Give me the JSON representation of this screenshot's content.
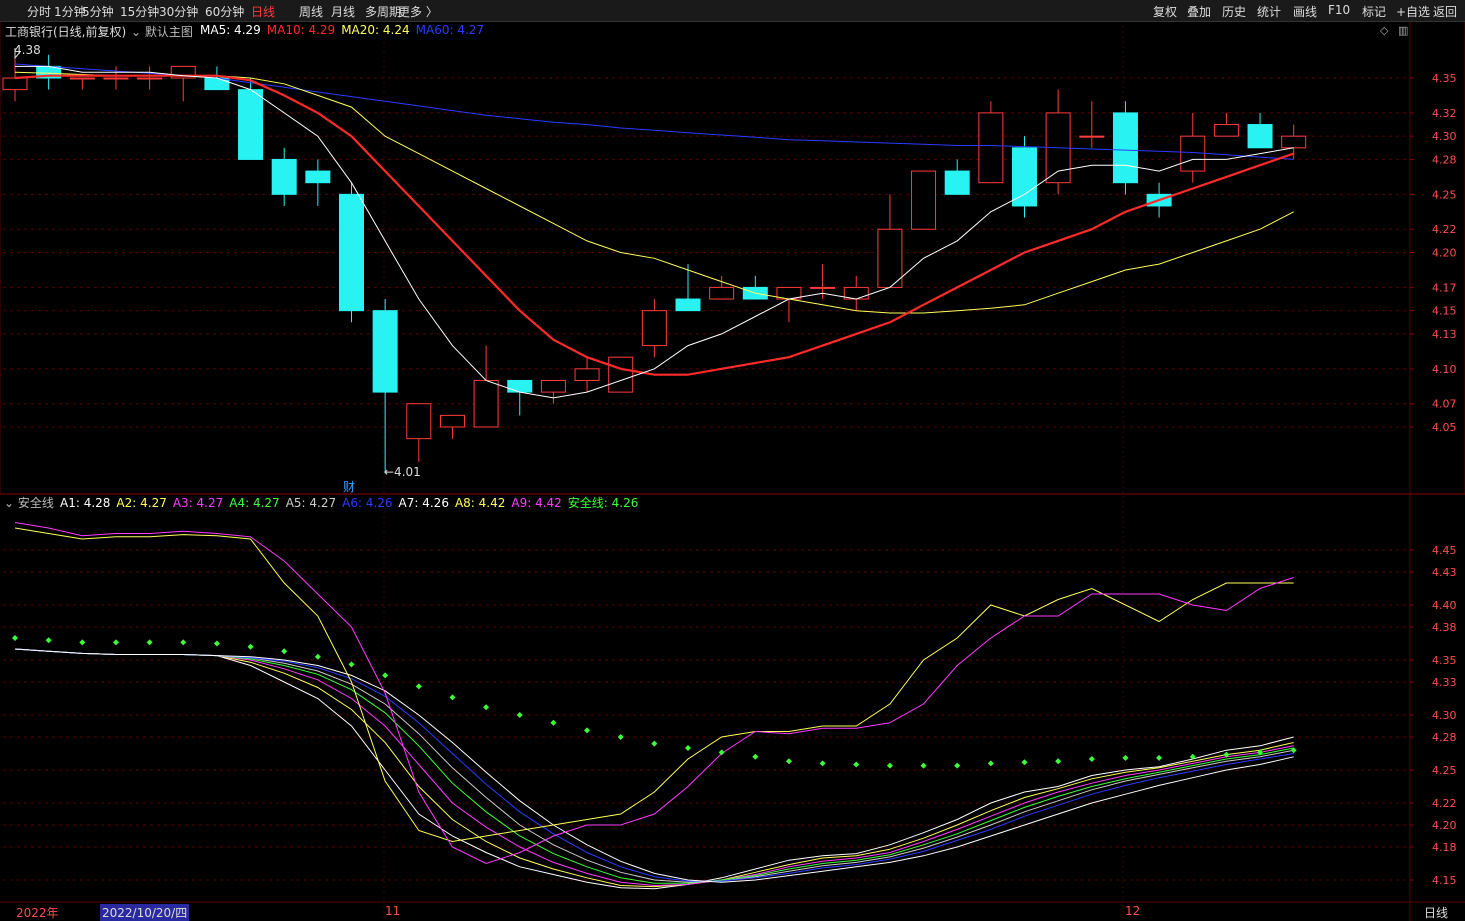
{
  "toolbar": {
    "periods": [
      "分时",
      "1分钟",
      "5分钟",
      "15分钟",
      "30分钟",
      "60分钟",
      "日线",
      "周线",
      "月线",
      "多周期",
      "更多 〉"
    ],
    "active_period": "日线",
    "right_buttons": [
      "复权",
      "叠加",
      "历史",
      "统计",
      "画线",
      "F10",
      "标记",
      "+自选",
      "返回"
    ]
  },
  "main_panel": {
    "stock_name": "工商银行(日线,前复权)",
    "template": "默认主图",
    "ma_legend": [
      {
        "label": "MA5: 4.29",
        "color": "#ffffff"
      },
      {
        "label": "MA10: 4.29",
        "color": "#ff2a2a"
      },
      {
        "label": "MA20: 4.24",
        "color": "#ffff5a"
      },
      {
        "label": "MA60: 4.27",
        "color": "#2a3cff"
      }
    ],
    "high_marker": "4.38",
    "low_marker": "←4.01",
    "event_marker": "财"
  },
  "sub_panel": {
    "indicator": "安全线",
    "legend": [
      {
        "label": "A1: 4.28",
        "color": "#ffffff"
      },
      {
        "label": "A2: 4.27",
        "color": "#ffff5a"
      },
      {
        "label": "A3: 4.27",
        "color": "#ff3cff"
      },
      {
        "label": "A4: 4.27",
        "color": "#3cff3c"
      },
      {
        "label": "A5: 4.27",
        "color": "#cccccc"
      },
      {
        "label": "A6: 4.26",
        "color": "#2a3cff"
      },
      {
        "label": "A7: 4.26",
        "color": "#ffffff"
      },
      {
        "label": "A8: 4.42",
        "color": "#ffff5a"
      },
      {
        "label": "A9: 4.42",
        "color": "#ff3cff"
      },
      {
        "label": "安全线: 4.26",
        "color": "#3cff3c"
      }
    ]
  },
  "bottom_axis": {
    "labels": [
      "2022年",
      "2022/10/20/四",
      "11",
      "12"
    ],
    "period_label": "日线"
  },
  "colors": {
    "up": "#ff3b3b",
    "down": "#29f2f2",
    "ma5": "#ffffff",
    "ma10": "#ff2a2a",
    "ma20": "#ffff5a",
    "ma60": "#2a3cff",
    "safety": "#3cff3c",
    "grid": "#5a0000"
  },
  "chart_data": [
    {
      "type": "candlestick",
      "title": "工商银行(日线,前复权)",
      "y_ticks": [
        4.35,
        4.32,
        4.3,
        4.28,
        4.25,
        4.22,
        4.2,
        4.17,
        4.15,
        4.13,
        4.1,
        4.07,
        4.05
      ],
      "ylim": [
        4.01,
        4.38
      ],
      "candles": [
        {
          "o": 4.34,
          "h": 4.37,
          "l": 4.33,
          "c": 4.35
        },
        {
          "o": 4.36,
          "h": 4.37,
          "l": 4.34,
          "c": 4.35
        },
        {
          "o": 4.35,
          "h": 4.35,
          "l": 4.34,
          "c": 4.35
        },
        {
          "o": 4.35,
          "h": 4.36,
          "l": 4.34,
          "c": 4.35
        },
        {
          "o": 4.35,
          "h": 4.36,
          "l": 4.34,
          "c": 4.35
        },
        {
          "o": 4.35,
          "h": 4.36,
          "l": 4.33,
          "c": 4.36
        },
        {
          "o": 4.35,
          "h": 4.36,
          "l": 4.34,
          "c": 4.34
        },
        {
          "o": 4.34,
          "h": 4.35,
          "l": 4.28,
          "c": 4.28
        },
        {
          "o": 4.28,
          "h": 4.29,
          "l": 4.24,
          "c": 4.25
        },
        {
          "o": 4.27,
          "h": 4.28,
          "l": 4.24,
          "c": 4.26
        },
        {
          "o": 4.25,
          "h": 4.26,
          "l": 4.14,
          "c": 4.15
        },
        {
          "o": 4.15,
          "h": 4.16,
          "l": 4.01,
          "c": 4.08
        },
        {
          "o": 4.04,
          "h": 4.07,
          "l": 4.02,
          "c": 4.07
        },
        {
          "o": 4.05,
          "h": 4.06,
          "l": 4.04,
          "c": 4.06
        },
        {
          "o": 4.05,
          "h": 4.12,
          "l": 4.05,
          "c": 4.09
        },
        {
          "o": 4.09,
          "h": 4.09,
          "l": 4.06,
          "c": 4.08
        },
        {
          "o": 4.08,
          "h": 4.09,
          "l": 4.07,
          "c": 4.09
        },
        {
          "o": 4.09,
          "h": 4.11,
          "l": 4.08,
          "c": 4.1
        },
        {
          "o": 4.08,
          "h": 4.11,
          "l": 4.08,
          "c": 4.11
        },
        {
          "o": 4.12,
          "h": 4.16,
          "l": 4.11,
          "c": 4.15
        },
        {
          "o": 4.16,
          "h": 4.19,
          "l": 4.15,
          "c": 4.15
        },
        {
          "o": 4.16,
          "h": 4.18,
          "l": 4.16,
          "c": 4.17
        },
        {
          "o": 4.17,
          "h": 4.18,
          "l": 4.16,
          "c": 4.16
        },
        {
          "o": 4.16,
          "h": 4.17,
          "l": 4.14,
          "c": 4.17
        },
        {
          "o": 4.17,
          "h": 4.19,
          "l": 4.16,
          "c": 4.17
        },
        {
          "o": 4.16,
          "h": 4.18,
          "l": 4.15,
          "c": 4.17
        },
        {
          "o": 4.17,
          "h": 4.25,
          "l": 4.17,
          "c": 4.22
        },
        {
          "o": 4.22,
          "h": 4.27,
          "l": 4.22,
          "c": 4.27
        },
        {
          "o": 4.27,
          "h": 4.28,
          "l": 4.25,
          "c": 4.25
        },
        {
          "o": 4.26,
          "h": 4.33,
          "l": 4.26,
          "c": 4.32
        },
        {
          "o": 4.29,
          "h": 4.3,
          "l": 4.23,
          "c": 4.24
        },
        {
          "o": 4.26,
          "h": 4.34,
          "l": 4.25,
          "c": 4.32
        },
        {
          "o": 4.3,
          "h": 4.33,
          "l": 4.29,
          "c": 4.3
        },
        {
          "o": 4.32,
          "h": 4.33,
          "l": 4.25,
          "c": 4.26
        },
        {
          "o": 4.25,
          "h": 4.26,
          "l": 4.23,
          "c": 4.24
        },
        {
          "o": 4.27,
          "h": 4.32,
          "l": 4.26,
          "c": 4.3
        },
        {
          "o": 4.3,
          "h": 4.32,
          "l": 4.3,
          "c": 4.31
        },
        {
          "o": 4.31,
          "h": 4.32,
          "l": 4.29,
          "c": 4.29
        },
        {
          "o": 4.29,
          "h": 4.31,
          "l": 4.28,
          "c": 4.3
        }
      ],
      "ma": {
        "MA5": [
          4.36,
          4.36,
          4.355,
          4.355,
          4.355,
          4.352,
          4.35,
          4.34,
          4.32,
          4.3,
          4.26,
          4.21,
          4.16,
          4.12,
          4.09,
          4.08,
          4.075,
          4.08,
          4.09,
          4.1,
          4.12,
          4.13,
          4.145,
          4.16,
          4.165,
          4.16,
          4.17,
          4.195,
          4.21,
          4.235,
          4.25,
          4.27,
          4.275,
          4.275,
          4.27,
          4.28,
          4.28,
          4.285,
          4.29
        ],
        "MA10": [
          4.35,
          4.352,
          4.352,
          4.352,
          4.352,
          4.352,
          4.352,
          4.348,
          4.335,
          4.32,
          4.3,
          4.27,
          4.24,
          4.21,
          4.18,
          4.15,
          4.125,
          4.11,
          4.1,
          4.095,
          4.095,
          4.1,
          4.105,
          4.11,
          4.12,
          4.13,
          4.14,
          4.155,
          4.17,
          4.185,
          4.2,
          4.21,
          4.22,
          4.235,
          4.245,
          4.255,
          4.265,
          4.275,
          4.285
        ],
        "MA20": [
          4.355,
          4.354,
          4.353,
          4.352,
          4.352,
          4.352,
          4.352,
          4.35,
          4.345,
          4.335,
          4.325,
          4.3,
          4.285,
          4.27,
          4.255,
          4.24,
          4.225,
          4.21,
          4.2,
          4.195,
          4.185,
          4.175,
          4.165,
          4.16,
          4.155,
          4.15,
          4.148,
          4.148,
          4.15,
          4.152,
          4.155,
          4.165,
          4.175,
          4.185,
          4.19,
          4.2,
          4.21,
          4.22,
          4.235
        ],
        "MA60": [
          4.362,
          4.36,
          4.358,
          4.356,
          4.354,
          4.352,
          4.35,
          4.346,
          4.342,
          4.338,
          4.334,
          4.33,
          4.326,
          4.322,
          4.318,
          4.315,
          4.312,
          4.31,
          4.307,
          4.305,
          4.303,
          4.301,
          4.299,
          4.297,
          4.296,
          4.295,
          4.294,
          4.293,
          4.292,
          4.292,
          4.291,
          4.29,
          4.289,
          4.288,
          4.287,
          4.286,
          4.284,
          4.282,
          4.28
        ]
      }
    },
    {
      "type": "line",
      "title": "安全线",
      "y_ticks": [
        4.45,
        4.43,
        4.4,
        4.38,
        4.35,
        4.33,
        4.3,
        4.28,
        4.25,
        4.22,
        4.2,
        4.18,
        4.15
      ],
      "ylim": [
        4.13,
        4.48
      ],
      "series": [
        {
          "name": "A1",
          "color": "#ffffff",
          "values": [
            4.36,
            4.358,
            4.356,
            4.355,
            4.355,
            4.355,
            4.354,
            4.345,
            4.33,
            4.315,
            4.29,
            4.25,
            4.21,
            4.19,
            4.175,
            4.162,
            4.155,
            4.148,
            4.143,
            4.142,
            4.146,
            4.152,
            4.16,
            4.168,
            4.172,
            4.174,
            4.182,
            4.193,
            4.205,
            4.22,
            4.23,
            4.235,
            4.245,
            4.25,
            4.253,
            4.26,
            4.268,
            4.272,
            4.28
          ]
        },
        {
          "name": "A2",
          "color": "#ffff5a",
          "values": [
            4.36,
            4.358,
            4.356,
            4.355,
            4.355,
            4.355,
            4.354,
            4.348,
            4.338,
            4.325,
            4.305,
            4.275,
            4.235,
            4.205,
            4.185,
            4.17,
            4.16,
            4.152,
            4.145,
            4.144,
            4.146,
            4.15,
            4.157,
            4.164,
            4.17,
            4.172,
            4.178,
            4.188,
            4.2,
            4.213,
            4.225,
            4.233,
            4.242,
            4.248,
            4.252,
            4.258,
            4.264,
            4.268,
            4.275
          ]
        },
        {
          "name": "A3",
          "color": "#ff3cff",
          "values": [
            4.36,
            4.358,
            4.356,
            4.355,
            4.355,
            4.355,
            4.354,
            4.35,
            4.342,
            4.332,
            4.315,
            4.29,
            4.255,
            4.22,
            4.198,
            4.18,
            4.166,
            4.156,
            4.148,
            4.145,
            4.146,
            4.15,
            4.155,
            4.162,
            4.167,
            4.17,
            4.175,
            4.185,
            4.196,
            4.208,
            4.22,
            4.23,
            4.238,
            4.245,
            4.25,
            4.256,
            4.262,
            4.266,
            4.272
          ]
        },
        {
          "name": "A4",
          "color": "#3cff3c",
          "values": [
            4.36,
            4.358,
            4.356,
            4.355,
            4.355,
            4.355,
            4.354,
            4.351,
            4.345,
            4.337,
            4.323,
            4.302,
            4.272,
            4.238,
            4.212,
            4.19,
            4.174,
            4.162,
            4.152,
            4.147,
            4.147,
            4.15,
            4.154,
            4.16,
            4.165,
            4.168,
            4.173,
            4.182,
            4.192,
            4.204,
            4.216,
            4.226,
            4.235,
            4.242,
            4.248,
            4.254,
            4.26,
            4.264,
            4.27
          ]
        },
        {
          "name": "A5",
          "color": "#cccccc",
          "values": [
            4.36,
            4.358,
            4.356,
            4.355,
            4.355,
            4.355,
            4.354,
            4.352,
            4.347,
            4.34,
            4.328,
            4.31,
            4.283,
            4.252,
            4.225,
            4.2,
            4.182,
            4.168,
            4.157,
            4.15,
            4.148,
            4.149,
            4.153,
            4.158,
            4.163,
            4.166,
            4.171,
            4.179,
            4.189,
            4.2,
            4.212,
            4.222,
            4.232,
            4.24,
            4.246,
            4.252,
            4.258,
            4.262,
            4.268
          ]
        },
        {
          "name": "A6",
          "color": "#2a3cff",
          "values": [
            4.36,
            4.358,
            4.356,
            4.355,
            4.355,
            4.355,
            4.354,
            4.352,
            4.349,
            4.343,
            4.333,
            4.317,
            4.293,
            4.265,
            4.237,
            4.212,
            4.192,
            4.175,
            4.162,
            4.153,
            4.149,
            4.149,
            4.152,
            4.156,
            4.161,
            4.164,
            4.169,
            4.176,
            4.186,
            4.196,
            4.208,
            4.218,
            4.228,
            4.236,
            4.243,
            4.249,
            4.255,
            4.26,
            4.265
          ]
        },
        {
          "name": "A7",
          "color": "#ffffff",
          "values": [
            4.36,
            4.358,
            4.356,
            4.355,
            4.355,
            4.355,
            4.354,
            4.353,
            4.35,
            4.345,
            4.336,
            4.322,
            4.3,
            4.275,
            4.248,
            4.222,
            4.2,
            4.182,
            4.167,
            4.156,
            4.15,
            4.148,
            4.15,
            4.154,
            4.158,
            4.162,
            4.166,
            4.172,
            4.18,
            4.19,
            4.2,
            4.21,
            4.22,
            4.228,
            4.236,
            4.243,
            4.25,
            4.255,
            4.262
          ]
        },
        {
          "name": "A8",
          "color": "#ffff5a",
          "values": [
            4.47,
            4.465,
            4.46,
            4.462,
            4.462,
            4.464,
            4.463,
            4.46,
            4.42,
            4.39,
            4.33,
            4.24,
            4.195,
            4.185,
            4.19,
            4.195,
            4.2,
            4.205,
            4.21,
            4.23,
            4.26,
            4.28,
            4.285,
            4.285,
            4.29,
            4.29,
            4.31,
            4.35,
            4.37,
            4.4,
            4.39,
            4.405,
            4.415,
            4.4,
            4.385,
            4.405,
            4.42,
            4.42,
            4.42
          ]
        },
        {
          "name": "A9",
          "color": "#ff3cff",
          "values": [
            4.475,
            4.47,
            4.463,
            4.465,
            4.465,
            4.467,
            4.465,
            4.462,
            4.44,
            4.41,
            4.38,
            4.32,
            4.23,
            4.18,
            4.165,
            4.175,
            4.19,
            4.2,
            4.2,
            4.21,
            4.235,
            4.265,
            4.285,
            4.283,
            4.288,
            4.288,
            4.293,
            4.31,
            4.345,
            4.37,
            4.39,
            4.39,
            4.41,
            4.41,
            4.41,
            4.4,
            4.395,
            4.415,
            4.425
          ]
        },
        {
          "name": "安全线",
          "color": "#3cff3c",
          "style": "dots",
          "values": [
            4.37,
            4.368,
            4.366,
            4.366,
            4.366,
            4.366,
            4.365,
            4.362,
            4.358,
            4.353,
            4.346,
            4.336,
            4.326,
            4.316,
            4.307,
            4.3,
            4.293,
            4.286,
            4.28,
            4.274,
            4.27,
            4.266,
            4.262,
            4.258,
            4.256,
            4.255,
            4.254,
            4.254,
            4.254,
            4.256,
            4.257,
            4.258,
            4.26,
            4.261,
            4.261,
            4.262,
            4.264,
            4.266,
            4.268
          ]
        }
      ]
    }
  ]
}
